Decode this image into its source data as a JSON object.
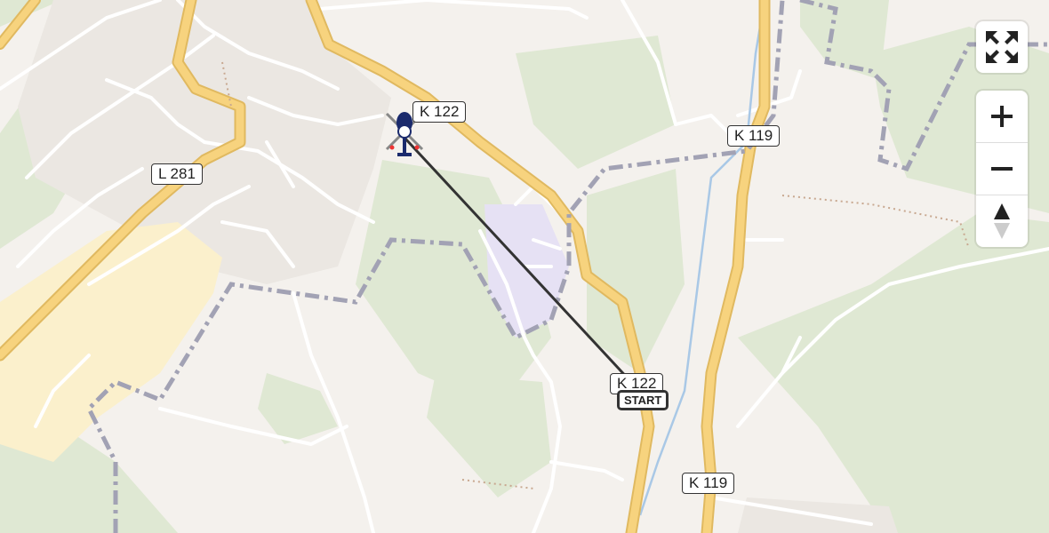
{
  "map": {
    "road_labels": [
      {
        "id": "k122-north",
        "text": "K 122"
      },
      {
        "id": "k119-north",
        "text": "K 119"
      },
      {
        "id": "l281",
        "text": "L 281"
      },
      {
        "id": "k122-south",
        "text": "K 122"
      },
      {
        "id": "k119-south",
        "text": "K 119"
      }
    ],
    "start_label": "START",
    "colors": {
      "background": "#f4f1ed",
      "forest": "#dfe8d3",
      "residential": "#ebe7e2",
      "industrial": "#fbf0cc",
      "major_road": "#f7d37e",
      "border": "#a2a2b4",
      "route": "#333333",
      "helicopter": "#1a2a6c"
    }
  },
  "controls": {
    "fullscreen_icon": "expand-arrows-icon",
    "zoom_in_icon": "plus-icon",
    "zoom_out_icon": "minus-icon",
    "compass_icon": "north-arrow-icon"
  }
}
